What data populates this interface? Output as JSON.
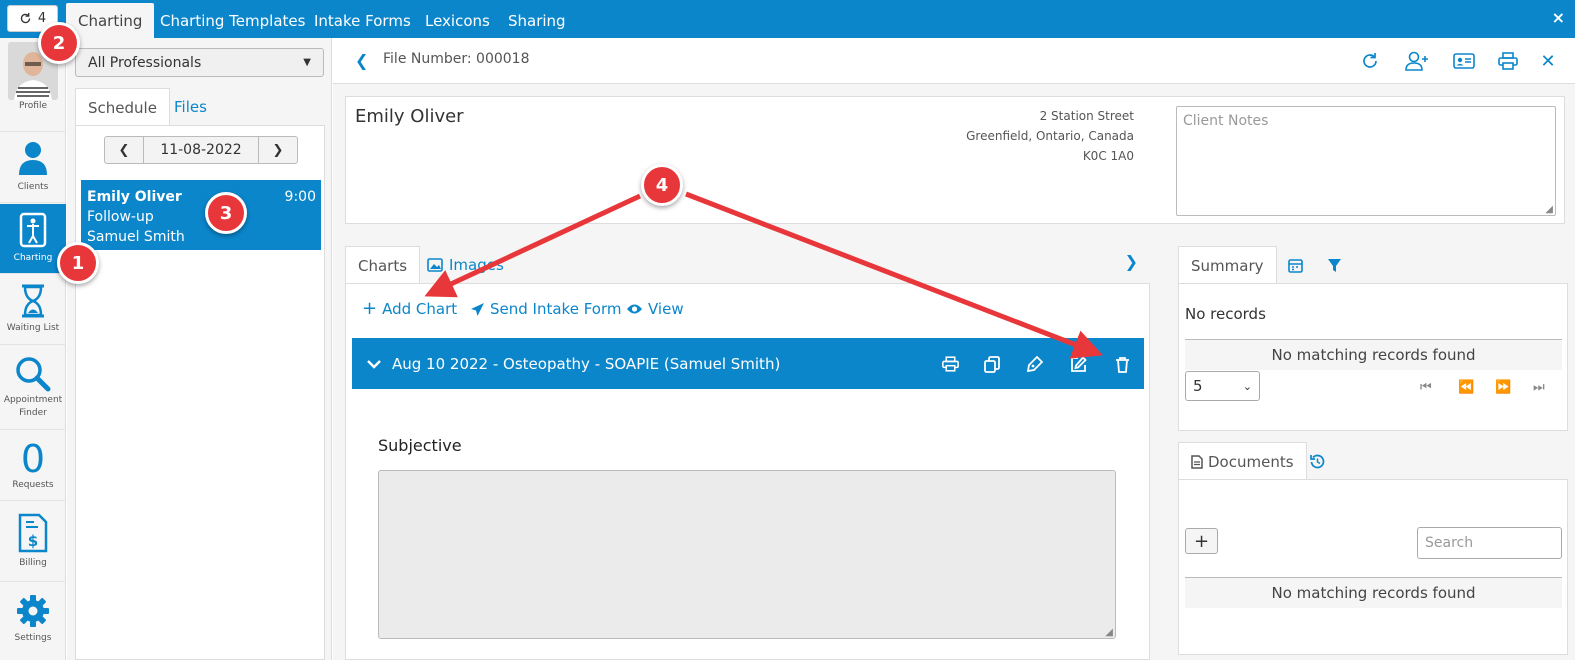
{
  "topbar": {
    "refresh_count": "4",
    "tabs": [
      "Charting",
      "Charting Templates",
      "Intake Forms",
      "Lexicons",
      "Sharing"
    ],
    "active_tab": "Charting",
    "close_glyph": "×"
  },
  "leftnav": {
    "items": [
      {
        "label": "Profile",
        "icon": "avatar"
      },
      {
        "label": "Clients",
        "icon": "person-icon"
      },
      {
        "label": "Charting",
        "icon": "charting-icon"
      },
      {
        "label": "Waiting List",
        "icon": "hourglass-icon"
      },
      {
        "label": "Appointment Finder",
        "icon": "magnifier-icon"
      },
      {
        "label": "Requests",
        "count": "0"
      },
      {
        "label": "Billing",
        "icon": "invoice-icon"
      },
      {
        "label": "Settings",
        "icon": "gear-icon"
      }
    ]
  },
  "schedule": {
    "professional_select": "All Professionals",
    "tabs": [
      "Schedule",
      "Files"
    ],
    "date": "11-08-2022",
    "appointment": {
      "client": "Emily Oliver",
      "time": "9:00",
      "type": "Follow-up",
      "professional": "Samuel Smith"
    }
  },
  "file": {
    "file_number": "File Number: 000018"
  },
  "client": {
    "name": "Emily Oliver",
    "address_line1": "2 Station Street",
    "address_line2": "Greenfield, Ontario, Canada",
    "postal": "K0C 1A0",
    "notes_placeholder": "Client Notes"
  },
  "charts": {
    "tabs": [
      "Charts",
      "Images"
    ],
    "actions": {
      "add_chart": "Add Chart",
      "send_intake": "Send Intake Form",
      "view": "View"
    },
    "entry": {
      "title": "Aug 10 2022 - Osteopathy - SOAPIE (Samuel Smith)",
      "section": "Subjective"
    }
  },
  "summary": {
    "tab": "Summary",
    "no_records": "No records",
    "no_matching": "No matching records found",
    "page_size": "5"
  },
  "documents": {
    "tab": "Documents",
    "add": "+",
    "search_placeholder": "Search",
    "no_matching": "No matching records found"
  },
  "annotations": {
    "badge1": "1",
    "badge2": "2",
    "badge3": "3",
    "badge4": "4"
  },
  "colors": {
    "brand": "#0b86cb",
    "annotation": "#e8373a"
  }
}
